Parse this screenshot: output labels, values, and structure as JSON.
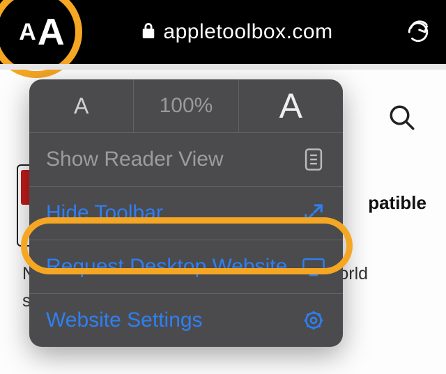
{
  "address_bar": {
    "domain": "appletoolbox.com"
  },
  "popover": {
    "zoom_level": "100%",
    "reader_label": "Show Reader View",
    "hide_toolbar_label": "Hide Toolbar",
    "request_desktop_label": "Request Desktop Website",
    "website_settings_label": "Website Settings"
  },
  "background": {
    "heading_fragment": "patible",
    "body_text": "N                                                                                   g services o                                                                                    ple is p                                                                                    etflix. But as the world screams"
  },
  "highlight_color": "#f5a623",
  "link_color": "#2f7ff2"
}
